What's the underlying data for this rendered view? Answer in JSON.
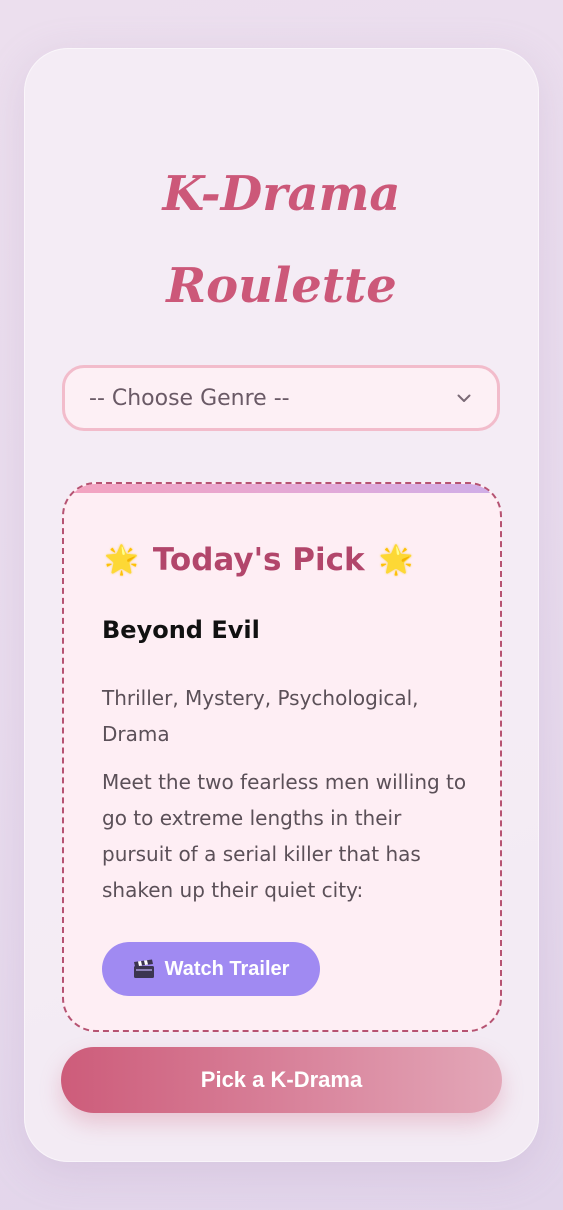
{
  "app": {
    "title": "K-Drama Roulette"
  },
  "genre_select": {
    "selected": "-- Choose Genre --"
  },
  "pick": {
    "heading": "Today's Pick",
    "star_icon": "star-emoji",
    "title": "Beyond Evil",
    "genres": "Thriller, Mystery, Psychological, Drama",
    "description": "Meet the two fearless men willing to go to extreme lengths in their pursuit of a serial killer that has shaken up their quiet city:",
    "trailer_label": "Watch Trailer",
    "trailer_icon": "clapperboard-icon"
  },
  "main_button": {
    "label": "Pick a K-Drama"
  },
  "colors": {
    "title": "#cc5879",
    "heading": "#b2466b",
    "trailer_button": "#a08af2",
    "main_button_start": "#cd5c7a",
    "main_button_end": "#e3a7b8",
    "select_border": "#f2bccb",
    "card_border": "#b65372"
  }
}
